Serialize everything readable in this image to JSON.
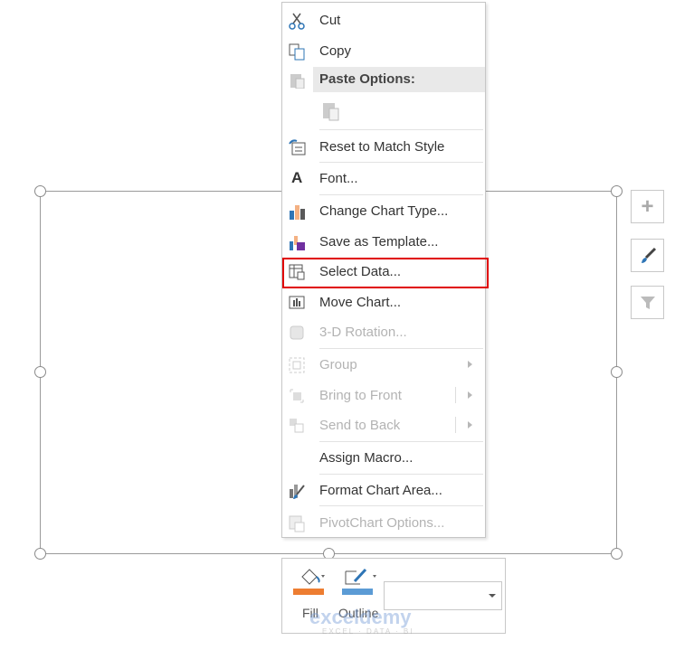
{
  "menu": {
    "items": [
      {
        "label": "Cut",
        "icon": "scissors-icon",
        "enabled": true
      },
      {
        "label": "Copy",
        "icon": "copy-icon",
        "enabled": true
      },
      {
        "label": "Paste Options:",
        "icon": "paste-icon",
        "enabled": false
      },
      {
        "label": "Reset to Match Style",
        "icon": "reset-style-icon",
        "enabled": true
      },
      {
        "label": "Font...",
        "icon": "font-icon",
        "enabled": true
      },
      {
        "label": "Change Chart Type...",
        "icon": "chart-type-icon",
        "enabled": true
      },
      {
        "label": "Save as Template...",
        "icon": "save-template-icon",
        "enabled": true
      },
      {
        "label": "Select Data...",
        "icon": "select-data-icon",
        "enabled": true
      },
      {
        "label": "Move Chart...",
        "icon": "move-chart-icon",
        "enabled": true
      },
      {
        "label": "3-D Rotation...",
        "icon": "3d-rotation-icon",
        "enabled": false
      },
      {
        "label": "Group",
        "icon": "group-icon",
        "enabled": false
      },
      {
        "label": "Bring to Front",
        "icon": "bring-front-icon",
        "enabled": false
      },
      {
        "label": "Send to Back",
        "icon": "send-back-icon",
        "enabled": false
      },
      {
        "label": "Assign Macro...",
        "icon": "",
        "enabled": true
      },
      {
        "label": "Format Chart Area...",
        "icon": "format-area-icon",
        "enabled": true
      },
      {
        "label": "PivotChart Options...",
        "icon": "pivot-options-icon",
        "enabled": false
      }
    ],
    "highlight_color": "#e00000"
  },
  "mini_toolbar": {
    "fill_label": "Fill",
    "outline_label": "Outline",
    "fill_color": "#ed7d31",
    "outline_color": "#5b9bd5",
    "dropdown_value": ""
  },
  "watermark": {
    "brand": "exceldemy",
    "tagline": "EXCEL · DATA · BI"
  }
}
